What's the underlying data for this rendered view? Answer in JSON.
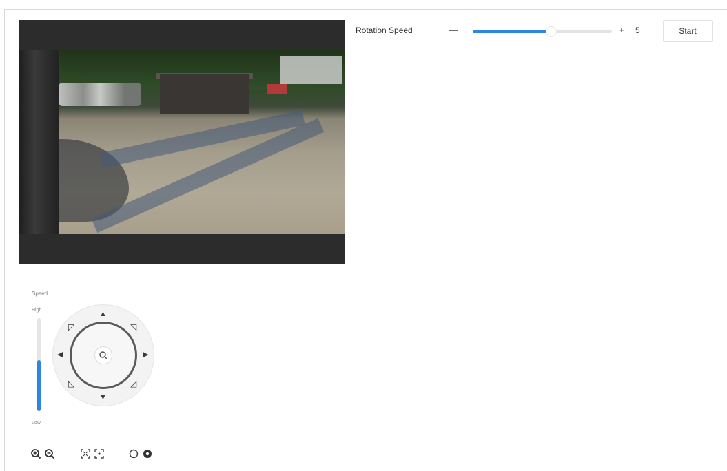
{
  "ptz": {
    "speed_title": "Speed",
    "speed_high": "High",
    "speed_low": "Low",
    "speed_level": 0.55,
    "icons": {
      "up": "arrow-up",
      "down": "arrow-down",
      "left": "arrow-left",
      "right": "arrow-right",
      "up_left": "arrow-up-left",
      "up_right": "arrow-up-right",
      "down_left": "arrow-down-left",
      "down_right": "arrow-down-right",
      "center": "zoom-icon"
    },
    "toolbar": [
      "zoom-in-icon",
      "zoom-out-icon",
      "focus-near-icon",
      "focus-far-icon",
      "iris-close-icon",
      "iris-open-icon"
    ]
  },
  "rotation": {
    "label": "Rotation Speed",
    "minus": "—",
    "plus": "+",
    "value": "5",
    "level": 0.55,
    "start_label": "Start"
  },
  "colors": {
    "accent": "#2f86e0",
    "border": "#e2e2e2"
  }
}
